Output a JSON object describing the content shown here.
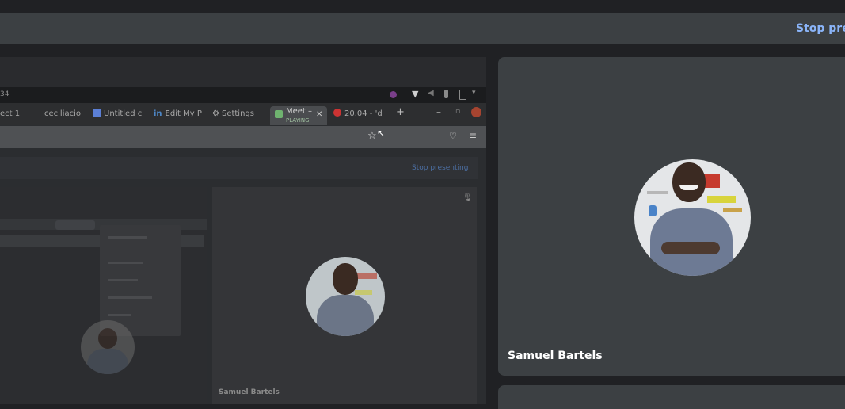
{
  "banner": {
    "stop_label": "Stop prese"
  },
  "main_tile": {
    "participant_name": "Samuel Bartels"
  },
  "shared_screen": {
    "clock": "34",
    "tabs": [
      {
        "label": "ect 1"
      },
      {
        "label": "ceciliacio"
      },
      {
        "label": "Untitled c"
      },
      {
        "label": "Edit My P"
      },
      {
        "label": "Settings"
      },
      {
        "label": "Meet –",
        "sub": "PLAYING"
      },
      {
        "label": "20.04 - 'd"
      }
    ],
    "inner_stop_label": "Stop presenting",
    "inner_participant_name": "Samuel Bartels"
  }
}
